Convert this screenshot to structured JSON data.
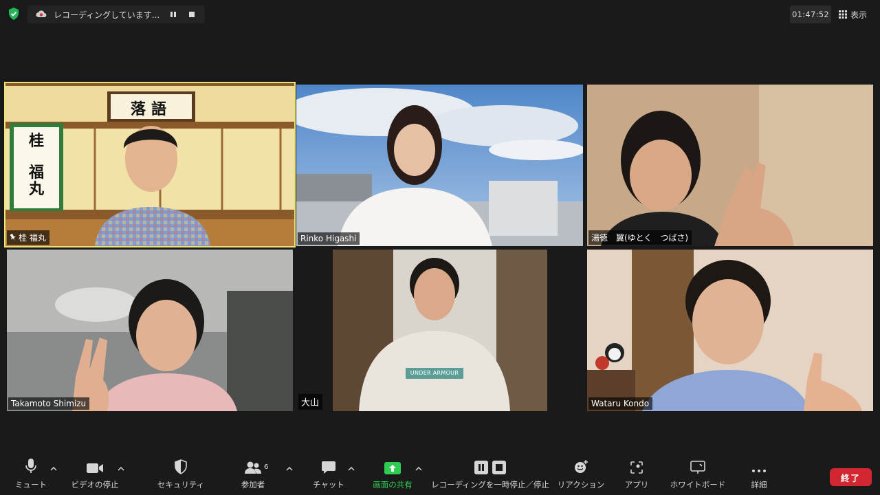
{
  "topbar": {
    "recording_status": "レコーディングしています...",
    "clock": "01:47:52",
    "view_label": "表示"
  },
  "participants": [
    {
      "name": "桂 福丸",
      "pinned": true,
      "active_speaker": true,
      "virtual_bg": "落語"
    },
    {
      "name": "Rinko Higashi"
    },
    {
      "name": "湯徳　翼(ゆとく　つばさ)"
    },
    {
      "name": "Takamoto Shimizu"
    },
    {
      "name": "大山"
    },
    {
      "name": "Wataru Kondo"
    }
  ],
  "backdrop_text": {
    "banner": "落語",
    "scroll_1": "桂",
    "scroll_2": "福",
    "scroll_3": "丸",
    "tshirt": "UNDER ARMOUR"
  },
  "toolbar": {
    "mute": "ミュート",
    "video": "ビデオの停止",
    "security": "セキュリティ",
    "participants": "参加者",
    "participants_count": "6",
    "chat": "チャット",
    "share": "画面の共有",
    "recording": "レコーディングを一時停止／停止",
    "reactions": "リアクション",
    "apps": "アプリ",
    "whiteboard": "ホワイトボード",
    "more": "詳細",
    "end": "終了"
  },
  "colors": {
    "share_green": "#2ecc50",
    "end_red": "#d22630",
    "active_border": "#e8e27a"
  }
}
